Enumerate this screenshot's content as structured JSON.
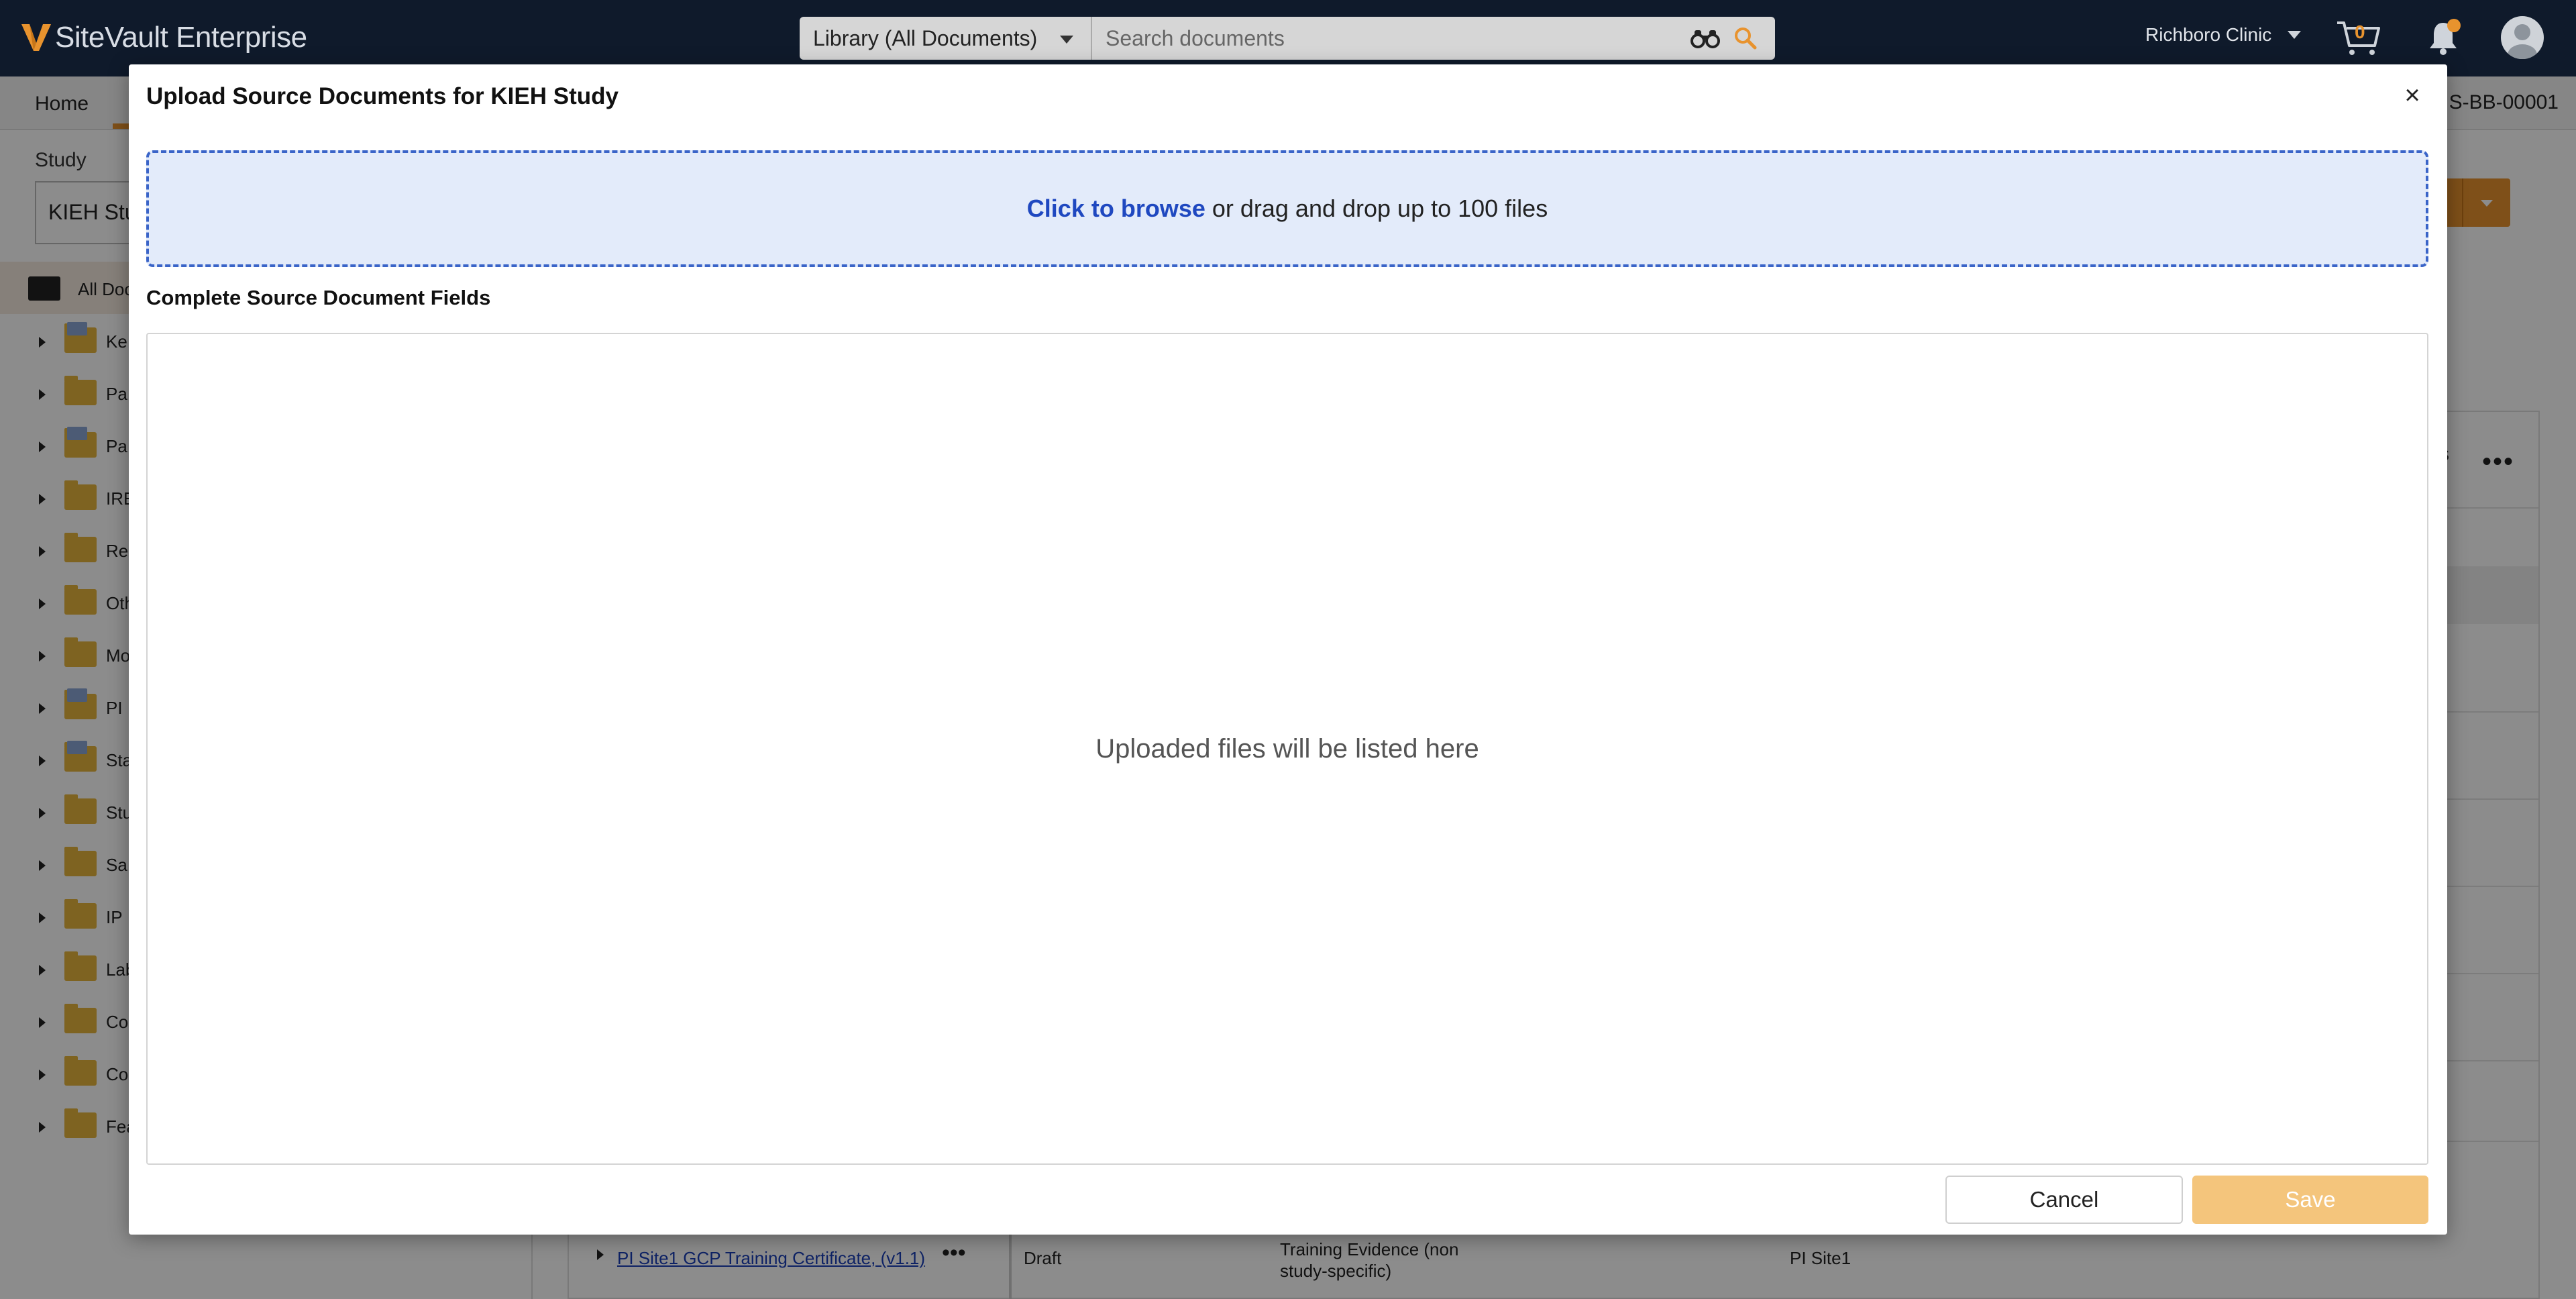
{
  "app": {
    "brand": "SiteVault Enterprise",
    "brand_color": "#e8932e"
  },
  "header": {
    "scope_select": "Library (All Documents)",
    "search_placeholder": "Search documents",
    "clinic": "Richboro Clinic",
    "cart_count": "0"
  },
  "background": {
    "nav_home": "Home",
    "doc_id_fragment": "S-BB-00001",
    "study_label": "Study",
    "study_value_fragment": "KIEH Stu",
    "tree_root_label": "All Doc",
    "tree_items": [
      "Ke",
      "Pa",
      "Pa",
      "IRE",
      "Re",
      "Oth",
      "Mo",
      "PI",
      "Sta",
      "Stu",
      "Sa",
      "IP",
      "Lab",
      "Co",
      "Co",
      "Fea"
    ],
    "header_fragment": "s",
    "row": {
      "name": "PI Site1 GCP Training Certificate, (v1.1)",
      "status": "Draft",
      "type": "Training Evidence (non study-specific)",
      "owner": "PI Site1"
    }
  },
  "modal": {
    "title": "Upload Source Documents for KIEH Study",
    "close_label": "×",
    "dropzone": {
      "browse_label": "Click to browse",
      "hint": "or drag and drop up to 100 files"
    },
    "section_label": "Complete Source Document Fields",
    "empty_message": "Uploaded files will be listed here",
    "cancel_label": "Cancel",
    "save_label": "Save"
  }
}
